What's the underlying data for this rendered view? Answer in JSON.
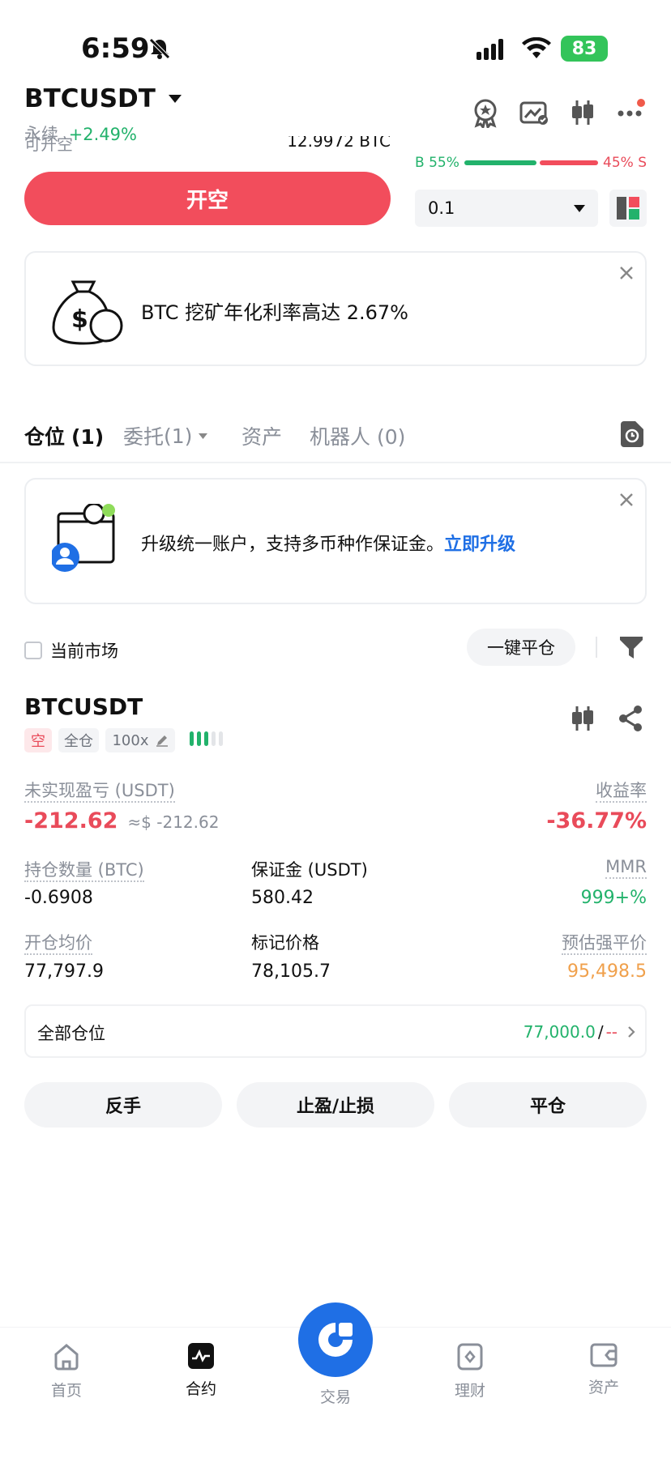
{
  "status_bar": {
    "time": "6:59",
    "battery": "83"
  },
  "header": {
    "pair": "BTCUSDT",
    "contract_type": "永续",
    "change": "+2.49%",
    "icons": [
      "award-icon",
      "chart-toggle-icon",
      "candlestick-icon",
      "more-icon"
    ]
  },
  "order_panel": {
    "available_label": "可开空",
    "available_value": "12.9972 BTC",
    "open_short_button": "开空",
    "buy_ratio": "B 55%",
    "sell_ratio": "45% S",
    "buy_percent": 55,
    "quantity_select": "0.1"
  },
  "promo_banner": {
    "text": "BTC 挖矿年化利率高达 2.67%"
  },
  "tabs": [
    {
      "label": "仓位",
      "count": "(1)"
    },
    {
      "label": "委托",
      "count": "(1)"
    },
    {
      "label": "资产",
      "count": ""
    },
    {
      "label": "机器人",
      "count": "(0)"
    }
  ],
  "upgrade_banner": {
    "text": "升级统一账户，支持多币种作保证金。",
    "link": "立即升级"
  },
  "filters": {
    "current_market": "当前市场",
    "close_all": "一键平仓"
  },
  "position": {
    "symbol": "BTCUSDT",
    "side_tag": "空",
    "margin_tag": "全仓",
    "leverage_tag": "100x",
    "unrealized_pnl_label": "未实现盈亏 (USDT)",
    "unrealized_pnl": "-212.62",
    "unrealized_pnl_usd": "≈$ -212.62",
    "roe_label": "收益率",
    "roe": "-36.77%",
    "size_label": "持仓数量 (BTC)",
    "size": "-0.6908",
    "margin_label": "保证金 (USDT)",
    "margin": "580.42",
    "mmr_label": "MMR",
    "mmr": "999+%",
    "entry_label": "开仓均价",
    "entry": "77,797.9",
    "mark_label": "标记价格",
    "mark": "78,105.7",
    "liq_label": "预估强平价",
    "liq": "95,498.5",
    "all_positions_label": "全部仓位",
    "tp_value": "77,000.0",
    "sl_separator": "/",
    "sl_value": "--",
    "reverse_button": "反手",
    "tpsl_button": "止盈/止损",
    "close_button": "平仓"
  },
  "bottom_nav": [
    {
      "label": "首页",
      "icon": "home-icon"
    },
    {
      "label": "合约",
      "icon": "futures-icon"
    },
    {
      "label": "交易",
      "icon": "trade-icon"
    },
    {
      "label": "理财",
      "icon": "earn-icon"
    },
    {
      "label": "资产",
      "icon": "assets-icon"
    }
  ],
  "colors": {
    "red": "#f24d5c",
    "green": "#22b26b",
    "blue": "#1f6fe5",
    "orange": "#f0a04b"
  }
}
